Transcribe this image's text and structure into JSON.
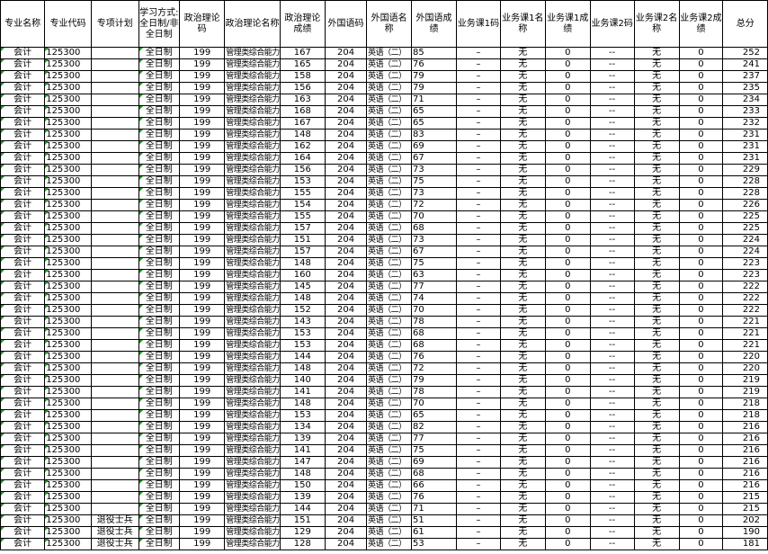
{
  "headers": [
    "专业名称",
    "专业代码",
    "专项计划",
    "学习方式:全日制/非全日制",
    "政治理论码",
    "政治理论名称",
    "政治理论成绩",
    "外国语码",
    "外国语名称",
    "外国语成绩",
    "业务课1码",
    "业务课1名称",
    "业务课1成绩",
    "业务课2码",
    "业务课2名称",
    "业务课2成绩",
    "总分"
  ],
  "rows": [
    [
      "会计",
      "125300",
      "",
      "全日制",
      "199",
      "管理类综合能力",
      "167",
      "204",
      "英语（二）",
      "85",
      "–",
      "无",
      "0",
      "--",
      "无",
      "0",
      "252"
    ],
    [
      "会计",
      "125300",
      "",
      "全日制",
      "199",
      "管理类综合能力",
      "165",
      "204",
      "英语（二）",
      "76",
      "–",
      "无",
      "0",
      "--",
      "无",
      "0",
      "241"
    ],
    [
      "会计",
      "125300",
      "",
      "全日制",
      "199",
      "管理类综合能力",
      "158",
      "204",
      "英语（二）",
      "79",
      "–",
      "无",
      "0",
      "--",
      "无",
      "0",
      "237"
    ],
    [
      "会计",
      "125300",
      "",
      "全日制",
      "199",
      "管理类综合能力",
      "156",
      "204",
      "英语（二）",
      "79",
      "–",
      "无",
      "0",
      "--",
      "无",
      "0",
      "235"
    ],
    [
      "会计",
      "125300",
      "",
      "全日制",
      "199",
      "管理类综合能力",
      "163",
      "204",
      "英语（二）",
      "71",
      "–",
      "无",
      "0",
      "--",
      "无",
      "0",
      "234"
    ],
    [
      "会计",
      "125300",
      "",
      "全日制",
      "199",
      "管理类综合能力",
      "168",
      "204",
      "英语（二）",
      "65",
      "–",
      "无",
      "0",
      "--",
      "无",
      "0",
      "233"
    ],
    [
      "会计",
      "125300",
      "",
      "全日制",
      "199",
      "管理类综合能力",
      "167",
      "204",
      "英语（二）",
      "65",
      "–",
      "无",
      "0",
      "--",
      "无",
      "0",
      "232"
    ],
    [
      "会计",
      "125300",
      "",
      "全日制",
      "199",
      "管理类综合能力",
      "148",
      "204",
      "英语（二）",
      "83",
      "–",
      "无",
      "0",
      "--",
      "无",
      "0",
      "231"
    ],
    [
      "会计",
      "125300",
      "",
      "全日制",
      "199",
      "管理类综合能力",
      "162",
      "204",
      "英语（二）",
      "69",
      "–",
      "无",
      "0",
      "--",
      "无",
      "0",
      "231"
    ],
    [
      "会计",
      "125300",
      "",
      "全日制",
      "199",
      "管理类综合能力",
      "164",
      "204",
      "英语（二）",
      "67",
      "–",
      "无",
      "0",
      "--",
      "无",
      "0",
      "231"
    ],
    [
      "会计",
      "125300",
      "",
      "全日制",
      "199",
      "管理类综合能力",
      "156",
      "204",
      "英语（二）",
      "73",
      "–",
      "无",
      "0",
      "--",
      "无",
      "0",
      "229"
    ],
    [
      "会计",
      "125300",
      "",
      "全日制",
      "199",
      "管理类综合能力",
      "153",
      "204",
      "英语（二）",
      "75",
      "–",
      "无",
      "0",
      "--",
      "无",
      "0",
      "228"
    ],
    [
      "会计",
      "125300",
      "",
      "全日制",
      "199",
      "管理类综合能力",
      "155",
      "204",
      "英语（二）",
      "73",
      "–",
      "无",
      "0",
      "--",
      "无",
      "0",
      "228"
    ],
    [
      "会计",
      "125300",
      "",
      "全日制",
      "199",
      "管理类综合能力",
      "154",
      "204",
      "英语（二）",
      "72",
      "–",
      "无",
      "0",
      "--",
      "无",
      "0",
      "226"
    ],
    [
      "会计",
      "125300",
      "",
      "全日制",
      "199",
      "管理类综合能力",
      "155",
      "204",
      "英语（二）",
      "70",
      "–",
      "无",
      "0",
      "--",
      "无",
      "0",
      "225"
    ],
    [
      "会计",
      "125300",
      "",
      "全日制",
      "199",
      "管理类综合能力",
      "157",
      "204",
      "英语（二）",
      "68",
      "–",
      "无",
      "0",
      "--",
      "无",
      "0",
      "225"
    ],
    [
      "会计",
      "125300",
      "",
      "全日制",
      "199",
      "管理类综合能力",
      "151",
      "204",
      "英语（二）",
      "73",
      "–",
      "无",
      "0",
      "--",
      "无",
      "0",
      "224"
    ],
    [
      "会计",
      "125300",
      "",
      "全日制",
      "199",
      "管理类综合能力",
      "157",
      "204",
      "英语（二）",
      "67",
      "–",
      "无",
      "0",
      "--",
      "无",
      "0",
      "224"
    ],
    [
      "会计",
      "125300",
      "",
      "全日制",
      "199",
      "管理类综合能力",
      "148",
      "204",
      "英语（二）",
      "75",
      "–",
      "无",
      "0",
      "--",
      "无",
      "0",
      "223"
    ],
    [
      "会计",
      "125300",
      "",
      "全日制",
      "199",
      "管理类综合能力",
      "160",
      "204",
      "英语（二）",
      "63",
      "–",
      "无",
      "0",
      "--",
      "无",
      "0",
      "223"
    ],
    [
      "会计",
      "125300",
      "",
      "全日制",
      "199",
      "管理类综合能力",
      "145",
      "204",
      "英语（二）",
      "77",
      "–",
      "无",
      "0",
      "--",
      "无",
      "0",
      "222"
    ],
    [
      "会计",
      "125300",
      "",
      "全日制",
      "199",
      "管理类综合能力",
      "148",
      "204",
      "英语（二）",
      "74",
      "–",
      "无",
      "0",
      "--",
      "无",
      "0",
      "222"
    ],
    [
      "会计",
      "125300",
      "",
      "全日制",
      "199",
      "管理类综合能力",
      "152",
      "204",
      "英语（二）",
      "70",
      "–",
      "无",
      "0",
      "--",
      "无",
      "0",
      "222"
    ],
    [
      "会计",
      "125300",
      "",
      "全日制",
      "199",
      "管理类综合能力",
      "143",
      "204",
      "英语（二）",
      "78",
      "–",
      "无",
      "0",
      "--",
      "无",
      "0",
      "221"
    ],
    [
      "会计",
      "125300",
      "",
      "全日制",
      "199",
      "管理类综合能力",
      "153",
      "204",
      "英语（二）",
      "68",
      "–",
      "无",
      "0",
      "--",
      "无",
      "0",
      "221"
    ],
    [
      "会计",
      "125300",
      "",
      "全日制",
      "199",
      "管理类综合能力",
      "153",
      "204",
      "英语（二）",
      "68",
      "–",
      "无",
      "0",
      "--",
      "无",
      "0",
      "221"
    ],
    [
      "会计",
      "125300",
      "",
      "全日制",
      "199",
      "管理类综合能力",
      "144",
      "204",
      "英语（二）",
      "76",
      "–",
      "无",
      "0",
      "--",
      "无",
      "0",
      "220"
    ],
    [
      "会计",
      "125300",
      "",
      "全日制",
      "199",
      "管理类综合能力",
      "148",
      "204",
      "英语（二）",
      "72",
      "–",
      "无",
      "0",
      "--",
      "无",
      "0",
      "220"
    ],
    [
      "会计",
      "125300",
      "",
      "全日制",
      "199",
      "管理类综合能力",
      "140",
      "204",
      "英语（二）",
      "79",
      "–",
      "无",
      "0",
      "--",
      "无",
      "0",
      "219"
    ],
    [
      "会计",
      "125300",
      "",
      "全日制",
      "199",
      "管理类综合能力",
      "141",
      "204",
      "英语（二）",
      "78",
      "–",
      "无",
      "0",
      "--",
      "无",
      "0",
      "219"
    ],
    [
      "会计",
      "125300",
      "",
      "全日制",
      "199",
      "管理类综合能力",
      "148",
      "204",
      "英语（二）",
      "70",
      "–",
      "无",
      "0",
      "--",
      "无",
      "0",
      "218"
    ],
    [
      "会计",
      "125300",
      "",
      "全日制",
      "199",
      "管理类综合能力",
      "153",
      "204",
      "英语（二）",
      "65",
      "–",
      "无",
      "0",
      "--",
      "无",
      "0",
      "218"
    ],
    [
      "会计",
      "125300",
      "",
      "全日制",
      "199",
      "管理类综合能力",
      "134",
      "204",
      "英语（二）",
      "82",
      "–",
      "无",
      "0",
      "--",
      "无",
      "0",
      "216"
    ],
    [
      "会计",
      "125300",
      "",
      "全日制",
      "199",
      "管理类综合能力",
      "139",
      "204",
      "英语（二）",
      "77",
      "–",
      "无",
      "0",
      "--",
      "无",
      "0",
      "216"
    ],
    [
      "会计",
      "125300",
      "",
      "全日制",
      "199",
      "管理类综合能力",
      "141",
      "204",
      "英语（二）",
      "75",
      "–",
      "无",
      "0",
      "--",
      "无",
      "0",
      "216"
    ],
    [
      "会计",
      "125300",
      "",
      "全日制",
      "199",
      "管理类综合能力",
      "147",
      "204",
      "英语（二）",
      "69",
      "–",
      "无",
      "0",
      "--",
      "无",
      "0",
      "216"
    ],
    [
      "会计",
      "125300",
      "",
      "全日制",
      "199",
      "管理类综合能力",
      "148",
      "204",
      "英语（二）",
      "68",
      "–",
      "无",
      "0",
      "--",
      "无",
      "0",
      "216"
    ],
    [
      "会计",
      "125300",
      "",
      "全日制",
      "199",
      "管理类综合能力",
      "150",
      "204",
      "英语（二）",
      "66",
      "–",
      "无",
      "0",
      "--",
      "无",
      "0",
      "216"
    ],
    [
      "会计",
      "125300",
      "",
      "全日制",
      "199",
      "管理类综合能力",
      "139",
      "204",
      "英语（二）",
      "76",
      "–",
      "无",
      "0",
      "--",
      "无",
      "0",
      "215"
    ],
    [
      "会计",
      "125300",
      "",
      "全日制",
      "199",
      "管理类综合能力",
      "144",
      "204",
      "英语（二）",
      "71",
      "–",
      "无",
      "0",
      "--",
      "无",
      "0",
      "215"
    ],
    [
      "会计",
      "125300",
      "退役士兵",
      "全日制",
      "199",
      "管理类综合能力",
      "151",
      "204",
      "英语（二）",
      "51",
      "–",
      "无",
      "0",
      "--",
      "无",
      "0",
      "202"
    ],
    [
      "会计",
      "125300",
      "退役士兵",
      "全日制",
      "199",
      "管理类综合能力",
      "129",
      "204",
      "英语（二）",
      "61",
      "–",
      "无",
      "0",
      "--",
      "无",
      "0",
      "190"
    ],
    [
      "会计",
      "125300",
      "退役士兵",
      "全日制",
      "199",
      "管理类综合能力",
      "128",
      "204",
      "英语（二）",
      "53",
      "–",
      "无",
      "0",
      "--",
      "无",
      "0",
      "181"
    ]
  ]
}
